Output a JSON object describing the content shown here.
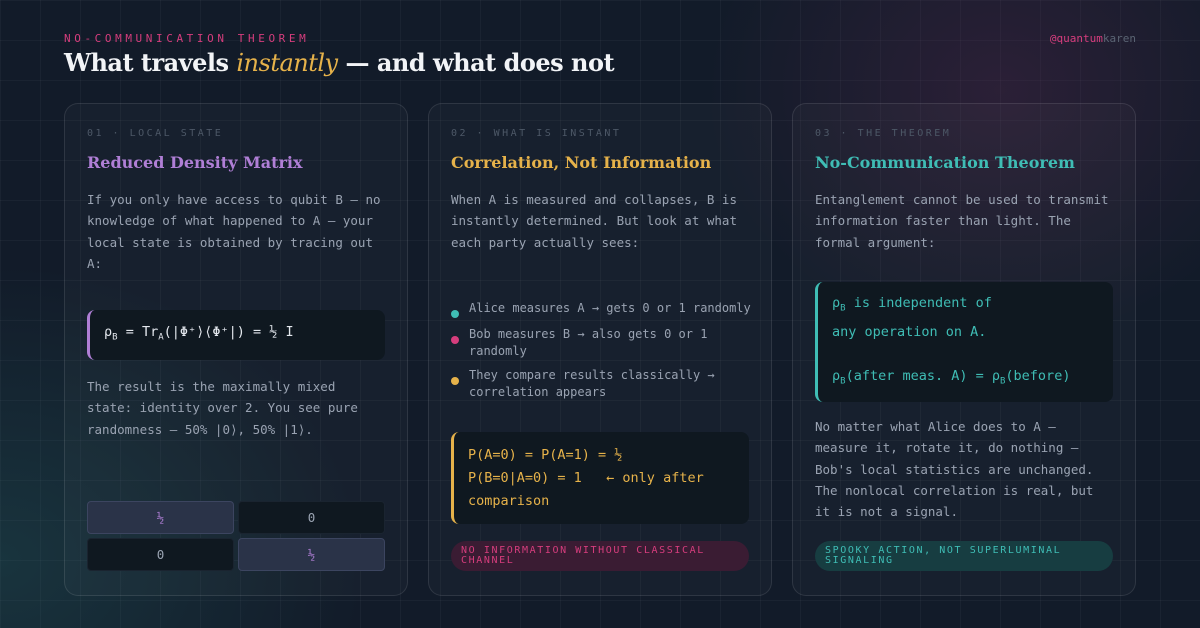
{
  "header": {
    "eyebrow": "NO-COMMUNICATION THEOREM",
    "title_pre": "What travels ",
    "title_em": "instantly",
    "title_post": " — and what does not",
    "handle_accent": "@quantum",
    "handle_rest": "karen"
  },
  "cards": [
    {
      "kicker": "01 · LOCAL STATE",
      "title": "Reduced Density Matrix",
      "intro": "If you only have access to qubit B — no knowledge of what happened to A — your local state is obtained by tracing out A:",
      "formula": {
        "rho": "ρ",
        "rho_sub": "B",
        "eq": " = Tr",
        "tr_sub": "A",
        "rest": "(|Φ⁺⟩⟨Φ⁺|) = ½ I"
      },
      "result": "The result is the maximally mixed state: identity over 2. You see pure randomness — 50% |0⟩, 50% |1⟩.",
      "matrix": [
        "½",
        "0",
        "0",
        "½"
      ]
    },
    {
      "kicker": "02 · WHAT IS INSTANT",
      "title": "Correlation, Not Information",
      "intro": "When A is measured and collapses, B is instantly determined. But look at what each party actually sees:",
      "bullets": [
        {
          "text": "Alice measures A → gets 0 or 1 randomly",
          "color": "#3fbdb5"
        },
        {
          "text": "Bob measures B → also gets 0 or 1 randomly",
          "color": "#d63d7d"
        },
        {
          "text": "They compare results classically → correlation appears",
          "color": "#e6b24a"
        }
      ],
      "formula_lines": [
        "P(A=0) = P(A=1) = ½",
        "P(B=0|A=0) = 1   ← only after",
        "comparison"
      ],
      "badge": "NO INFORMATION WITHOUT CLASSICAL CHANNEL"
    },
    {
      "kicker": "03 · THE THEOREM",
      "title": "No-Communication Theorem",
      "intro": "Entanglement cannot be used to transmit information faster than light. The formal argument:",
      "formula": {
        "line1_rho": "ρ",
        "line1_sub": "B",
        "line1_rest": " is independent of",
        "line2": "any operation on A.",
        "line3_a": "ρ",
        "line3_sub_a": "B",
        "line3_mid": "(after meas. A) = ρ",
        "line3_sub_b": "B",
        "line3_end": "(before)"
      },
      "body": "No matter what Alice does to A — measure it, rotate it, do nothing — Bob's local statistics are unchanged. The nonlocal correlation is real, but it is not a signal.",
      "badge": "SPOOKY ACTION, NOT SUPERLUMINAL SIGNALING"
    }
  ],
  "colors": {
    "pink": "#d63d7d",
    "gold": "#e6b24a",
    "teal": "#3fbdb5",
    "purple": "#b07fd6"
  }
}
